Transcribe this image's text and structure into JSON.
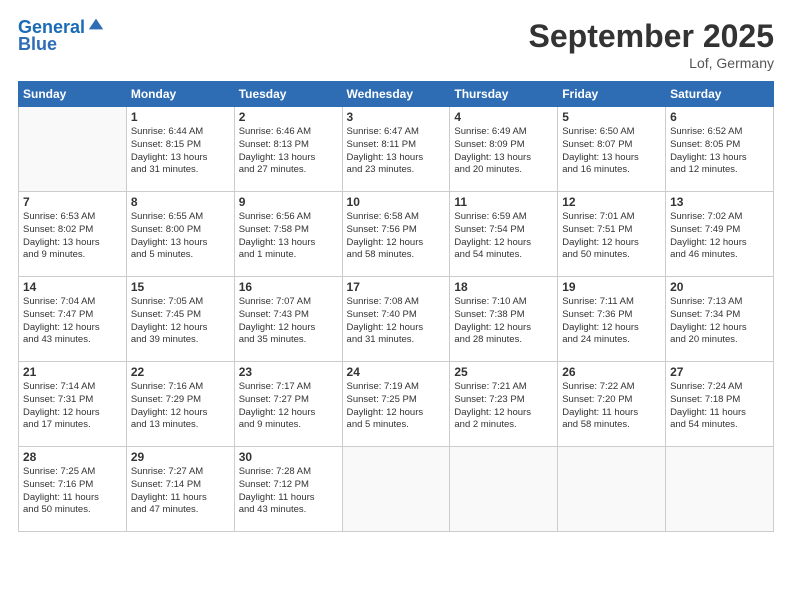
{
  "header": {
    "logo_line1": "General",
    "logo_line2": "Blue",
    "month": "September 2025",
    "location": "Lof, Germany"
  },
  "weekdays": [
    "Sunday",
    "Monday",
    "Tuesday",
    "Wednesday",
    "Thursday",
    "Friday",
    "Saturday"
  ],
  "weeks": [
    [
      {
        "day": "",
        "info": ""
      },
      {
        "day": "1",
        "info": "Sunrise: 6:44 AM\nSunset: 8:15 PM\nDaylight: 13 hours\nand 31 minutes."
      },
      {
        "day": "2",
        "info": "Sunrise: 6:46 AM\nSunset: 8:13 PM\nDaylight: 13 hours\nand 27 minutes."
      },
      {
        "day": "3",
        "info": "Sunrise: 6:47 AM\nSunset: 8:11 PM\nDaylight: 13 hours\nand 23 minutes."
      },
      {
        "day": "4",
        "info": "Sunrise: 6:49 AM\nSunset: 8:09 PM\nDaylight: 13 hours\nand 20 minutes."
      },
      {
        "day": "5",
        "info": "Sunrise: 6:50 AM\nSunset: 8:07 PM\nDaylight: 13 hours\nand 16 minutes."
      },
      {
        "day": "6",
        "info": "Sunrise: 6:52 AM\nSunset: 8:05 PM\nDaylight: 13 hours\nand 12 minutes."
      }
    ],
    [
      {
        "day": "7",
        "info": "Sunrise: 6:53 AM\nSunset: 8:02 PM\nDaylight: 13 hours\nand 9 minutes."
      },
      {
        "day": "8",
        "info": "Sunrise: 6:55 AM\nSunset: 8:00 PM\nDaylight: 13 hours\nand 5 minutes."
      },
      {
        "day": "9",
        "info": "Sunrise: 6:56 AM\nSunset: 7:58 PM\nDaylight: 13 hours\nand 1 minute."
      },
      {
        "day": "10",
        "info": "Sunrise: 6:58 AM\nSunset: 7:56 PM\nDaylight: 12 hours\nand 58 minutes."
      },
      {
        "day": "11",
        "info": "Sunrise: 6:59 AM\nSunset: 7:54 PM\nDaylight: 12 hours\nand 54 minutes."
      },
      {
        "day": "12",
        "info": "Sunrise: 7:01 AM\nSunset: 7:51 PM\nDaylight: 12 hours\nand 50 minutes."
      },
      {
        "day": "13",
        "info": "Sunrise: 7:02 AM\nSunset: 7:49 PM\nDaylight: 12 hours\nand 46 minutes."
      }
    ],
    [
      {
        "day": "14",
        "info": "Sunrise: 7:04 AM\nSunset: 7:47 PM\nDaylight: 12 hours\nand 43 minutes."
      },
      {
        "day": "15",
        "info": "Sunrise: 7:05 AM\nSunset: 7:45 PM\nDaylight: 12 hours\nand 39 minutes."
      },
      {
        "day": "16",
        "info": "Sunrise: 7:07 AM\nSunset: 7:43 PM\nDaylight: 12 hours\nand 35 minutes."
      },
      {
        "day": "17",
        "info": "Sunrise: 7:08 AM\nSunset: 7:40 PM\nDaylight: 12 hours\nand 31 minutes."
      },
      {
        "day": "18",
        "info": "Sunrise: 7:10 AM\nSunset: 7:38 PM\nDaylight: 12 hours\nand 28 minutes."
      },
      {
        "day": "19",
        "info": "Sunrise: 7:11 AM\nSunset: 7:36 PM\nDaylight: 12 hours\nand 24 minutes."
      },
      {
        "day": "20",
        "info": "Sunrise: 7:13 AM\nSunset: 7:34 PM\nDaylight: 12 hours\nand 20 minutes."
      }
    ],
    [
      {
        "day": "21",
        "info": "Sunrise: 7:14 AM\nSunset: 7:31 PM\nDaylight: 12 hours\nand 17 minutes."
      },
      {
        "day": "22",
        "info": "Sunrise: 7:16 AM\nSunset: 7:29 PM\nDaylight: 12 hours\nand 13 minutes."
      },
      {
        "day": "23",
        "info": "Sunrise: 7:17 AM\nSunset: 7:27 PM\nDaylight: 12 hours\nand 9 minutes."
      },
      {
        "day": "24",
        "info": "Sunrise: 7:19 AM\nSunset: 7:25 PM\nDaylight: 12 hours\nand 5 minutes."
      },
      {
        "day": "25",
        "info": "Sunrise: 7:21 AM\nSunset: 7:23 PM\nDaylight: 12 hours\nand 2 minutes."
      },
      {
        "day": "26",
        "info": "Sunrise: 7:22 AM\nSunset: 7:20 PM\nDaylight: 11 hours\nand 58 minutes."
      },
      {
        "day": "27",
        "info": "Sunrise: 7:24 AM\nSunset: 7:18 PM\nDaylight: 11 hours\nand 54 minutes."
      }
    ],
    [
      {
        "day": "28",
        "info": "Sunrise: 7:25 AM\nSunset: 7:16 PM\nDaylight: 11 hours\nand 50 minutes."
      },
      {
        "day": "29",
        "info": "Sunrise: 7:27 AM\nSunset: 7:14 PM\nDaylight: 11 hours\nand 47 minutes."
      },
      {
        "day": "30",
        "info": "Sunrise: 7:28 AM\nSunset: 7:12 PM\nDaylight: 11 hours\nand 43 minutes."
      },
      {
        "day": "",
        "info": ""
      },
      {
        "day": "",
        "info": ""
      },
      {
        "day": "",
        "info": ""
      },
      {
        "day": "",
        "info": ""
      }
    ]
  ]
}
